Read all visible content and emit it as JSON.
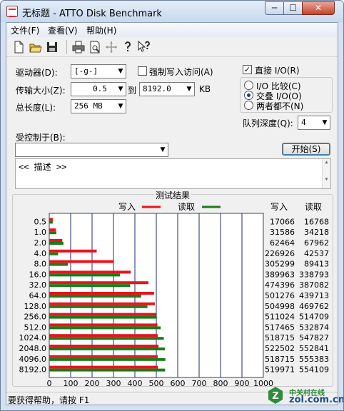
{
  "window": {
    "title": "无标题 - ATTO Disk Benchmark",
    "minimize_glyph": "─",
    "maximize_glyph": "☐",
    "close_glyph": "✕"
  },
  "menu": [
    "文件(F)",
    "查看(V)",
    "帮助(H)"
  ],
  "toolbar": {
    "icons": [
      "new-icon",
      "open-icon",
      "save-icon",
      "print-icon",
      "print-preview-icon",
      "move-icon",
      "help-icon",
      "context-help-icon"
    ]
  },
  "settings": {
    "drive_label": "驱动器(D):",
    "drive_value": "[-g-]",
    "force_write_label": "强制写入访问(A)",
    "force_write_checked": false,
    "transfer_label": "传输大小(Z):",
    "transfer_from": "0.5",
    "to_label": "到",
    "transfer_to": "8192.0",
    "transfer_unit": "KB",
    "total_label": "总长度(L):",
    "total_value": "256 MB",
    "direct_io_label": "直接 I/O(R)",
    "direct_io_checked": true,
    "io_compare_label": "I/O 比较(C)",
    "overlapped_label": "交叠 I/O(O)",
    "neither_label": "两者都不(N)",
    "io_mode_selected": "overlapped",
    "queue_label": "队列深度(Q):",
    "queue_value": "4",
    "controlled_label": "受控制于(B):",
    "controlled_value": "",
    "start_label": "开始(S)",
    "description": "<< 描述 >>"
  },
  "results": {
    "title": "测试结果",
    "write_legend": "写入",
    "read_legend": "读取",
    "write_col": "写入",
    "read_col": "读取"
  },
  "chart_data": {
    "type": "bar",
    "orientation": "horizontal",
    "title": "测试结果",
    "xlabel": "传输速率 - MB / 秒",
    "xlim": [
      0,
      1000
    ],
    "xticks": [
      "0",
      "100",
      "200",
      "300",
      "400",
      "500",
      "600",
      "700",
      "800",
      "900",
      "1000"
    ],
    "grid": true,
    "legend": "top-center",
    "categories": [
      "0.5",
      "1.0",
      "2.0",
      "4.0",
      "8.0",
      "16.0",
      "32.0",
      "64.0",
      "128.0",
      "256.0",
      "512.0",
      "1024.0",
      "2048.0",
      "4096.0",
      "8192.0"
    ],
    "series": [
      {
        "name": "写入",
        "color": "#e8141b",
        "values": [
          17066,
          31586,
          62464,
          226926,
          305299,
          389963,
          474396,
          501276,
          504998,
          511024,
          517465,
          518715,
          522502,
          518715,
          519971
        ]
      },
      {
        "name": "读取",
        "color": "#1a7d1a",
        "values": [
          16768,
          34218,
          67962,
          42537,
          89413,
          338793,
          387082,
          439713,
          469762,
          514709,
          532874,
          547827,
          552841,
          555383,
          554109
        ]
      }
    ],
    "value_unit": "KB/s"
  },
  "status": "要获得帮助，请按 F1",
  "watermark": {
    "line1": "中关村在线",
    "line2": "zol.com.cn",
    "badge": "Z"
  }
}
